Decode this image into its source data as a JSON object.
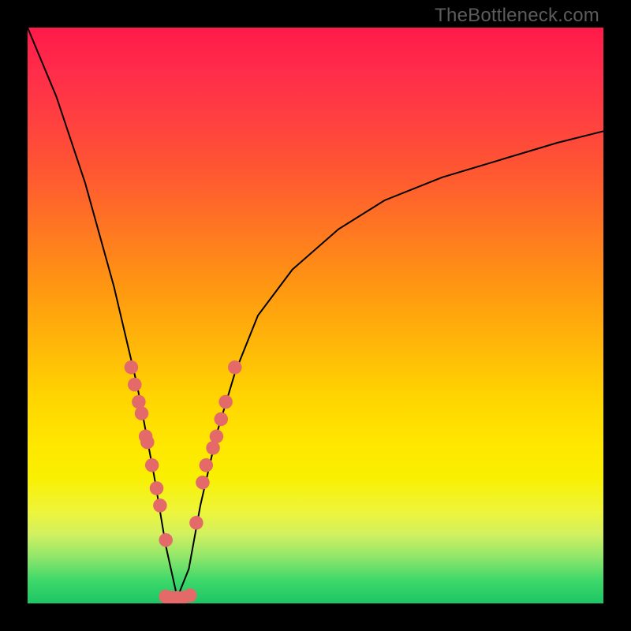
{
  "watermark": "TheBottleneck.com",
  "chart_data": {
    "type": "line",
    "title": "",
    "xlabel": "",
    "ylabel": "",
    "xlim": [
      0,
      100
    ],
    "ylim": [
      0,
      100
    ],
    "notch_x": 26,
    "series": [
      {
        "name": "bottleneck-curve",
        "x": [
          0,
          5,
          10,
          15,
          19,
          22,
          24,
          26,
          28,
          30,
          33,
          36,
          40,
          46,
          54,
          62,
          72,
          82,
          92,
          100
        ],
        "values": [
          100,
          88,
          73,
          55,
          38,
          22,
          10,
          1,
          6,
          17,
          30,
          40,
          50,
          58,
          65,
          70,
          74,
          77,
          80,
          82
        ]
      }
    ],
    "dots_left": {
      "x": [
        18.0,
        18.6,
        19.3,
        19.8,
        20.5,
        20.8,
        21.6,
        22.4,
        23.0,
        24.0
      ],
      "values": [
        41.0,
        38.0,
        35.0,
        33.0,
        29.0,
        28.0,
        24.0,
        20.0,
        17.0,
        11.0
      ]
    },
    "dots_bottom": {
      "x": [
        24.0,
        25.0,
        26.0,
        27.0,
        28.2
      ],
      "values": [
        1.2,
        1.0,
        1.0,
        1.0,
        1.4
      ]
    },
    "dots_right": {
      "x": [
        29.3,
        30.4,
        31.0,
        32.2,
        32.8,
        33.6,
        34.4,
        36.0
      ],
      "values": [
        14.0,
        21.0,
        24.0,
        27.0,
        29.0,
        32.0,
        35.0,
        41.0
      ]
    },
    "dot_radius": 1.2,
    "dot_color": "#e46a6a",
    "curve_color": "#000000",
    "curve_width": 2
  }
}
